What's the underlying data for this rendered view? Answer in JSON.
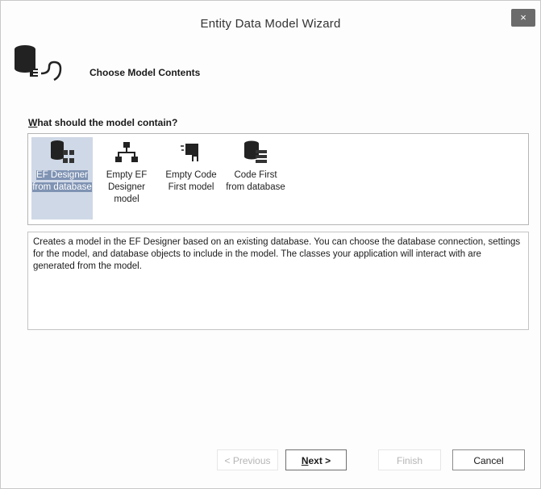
{
  "window": {
    "title": "Entity Data Model Wizard",
    "close_label": "×"
  },
  "header": {
    "title": "Choose Model Contents"
  },
  "question": {
    "accel": "W",
    "rest": "hat should the model contain?"
  },
  "options": [
    {
      "label": "EF Designer from database",
      "icon": "database-designer-icon",
      "selected": true
    },
    {
      "label": "Empty EF Designer model",
      "icon": "hierarchy-icon",
      "selected": false
    },
    {
      "label": "Empty Code First model",
      "icon": "code-first-icon",
      "selected": false
    },
    {
      "label": "Code First from database",
      "icon": "database-code-icon",
      "selected": false
    }
  ],
  "description": "Creates a model in the EF Designer based on an existing database. You can choose the database connection, settings for the model, and database objects to include in the model. The classes your application will interact with are generated from the model.",
  "buttons": {
    "previous": "< Previous",
    "next_accel": "N",
    "next_rest": "ext >",
    "finish": "Finish",
    "cancel": "Cancel"
  },
  "colors": {
    "selected_bg": "#cfd8e6",
    "selected_label": "#7f93b3",
    "close_bg": "#6b6b6b"
  }
}
